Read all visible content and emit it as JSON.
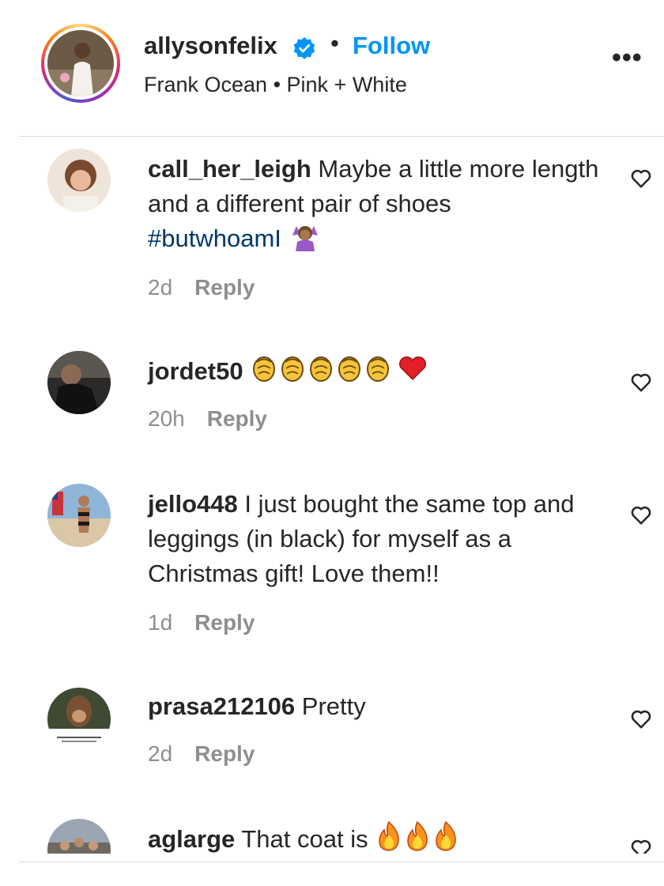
{
  "header": {
    "username": "allysonfelix",
    "separator": "•",
    "follow_label": "Follow",
    "audio": "Frank Ocean • Pink + White",
    "more_label": "•••"
  },
  "comments": [
    {
      "user": "call_her_leigh",
      "text": "Maybe a little more length and a different pair of shoes",
      "hashtag": "#butwhoamI",
      "emoji": "woman-shrugging",
      "time": "2d",
      "reply": "Reply"
    },
    {
      "user": "jordet50",
      "text": "",
      "emoji": "clapping-hands x6, red-heart",
      "time": "20h",
      "reply": "Reply"
    },
    {
      "user": "jello448",
      "text": "I just bought the same top and leggings (in black) for myself as a Christmas gift! Love them!!",
      "time": "1d",
      "reply": "Reply"
    },
    {
      "user": "prasa212106",
      "text": "Pretty",
      "time": "2d",
      "reply": "Reply"
    },
    {
      "user": "aglarge",
      "text": "That coat is",
      "emoji": "fire x3"
    }
  ],
  "colors": {
    "link_blue": "#0095f6",
    "hashtag": "#00376b",
    "meta_gray": "#8e8e8e",
    "text": "#262626",
    "verified_blue": "#0095f6"
  }
}
